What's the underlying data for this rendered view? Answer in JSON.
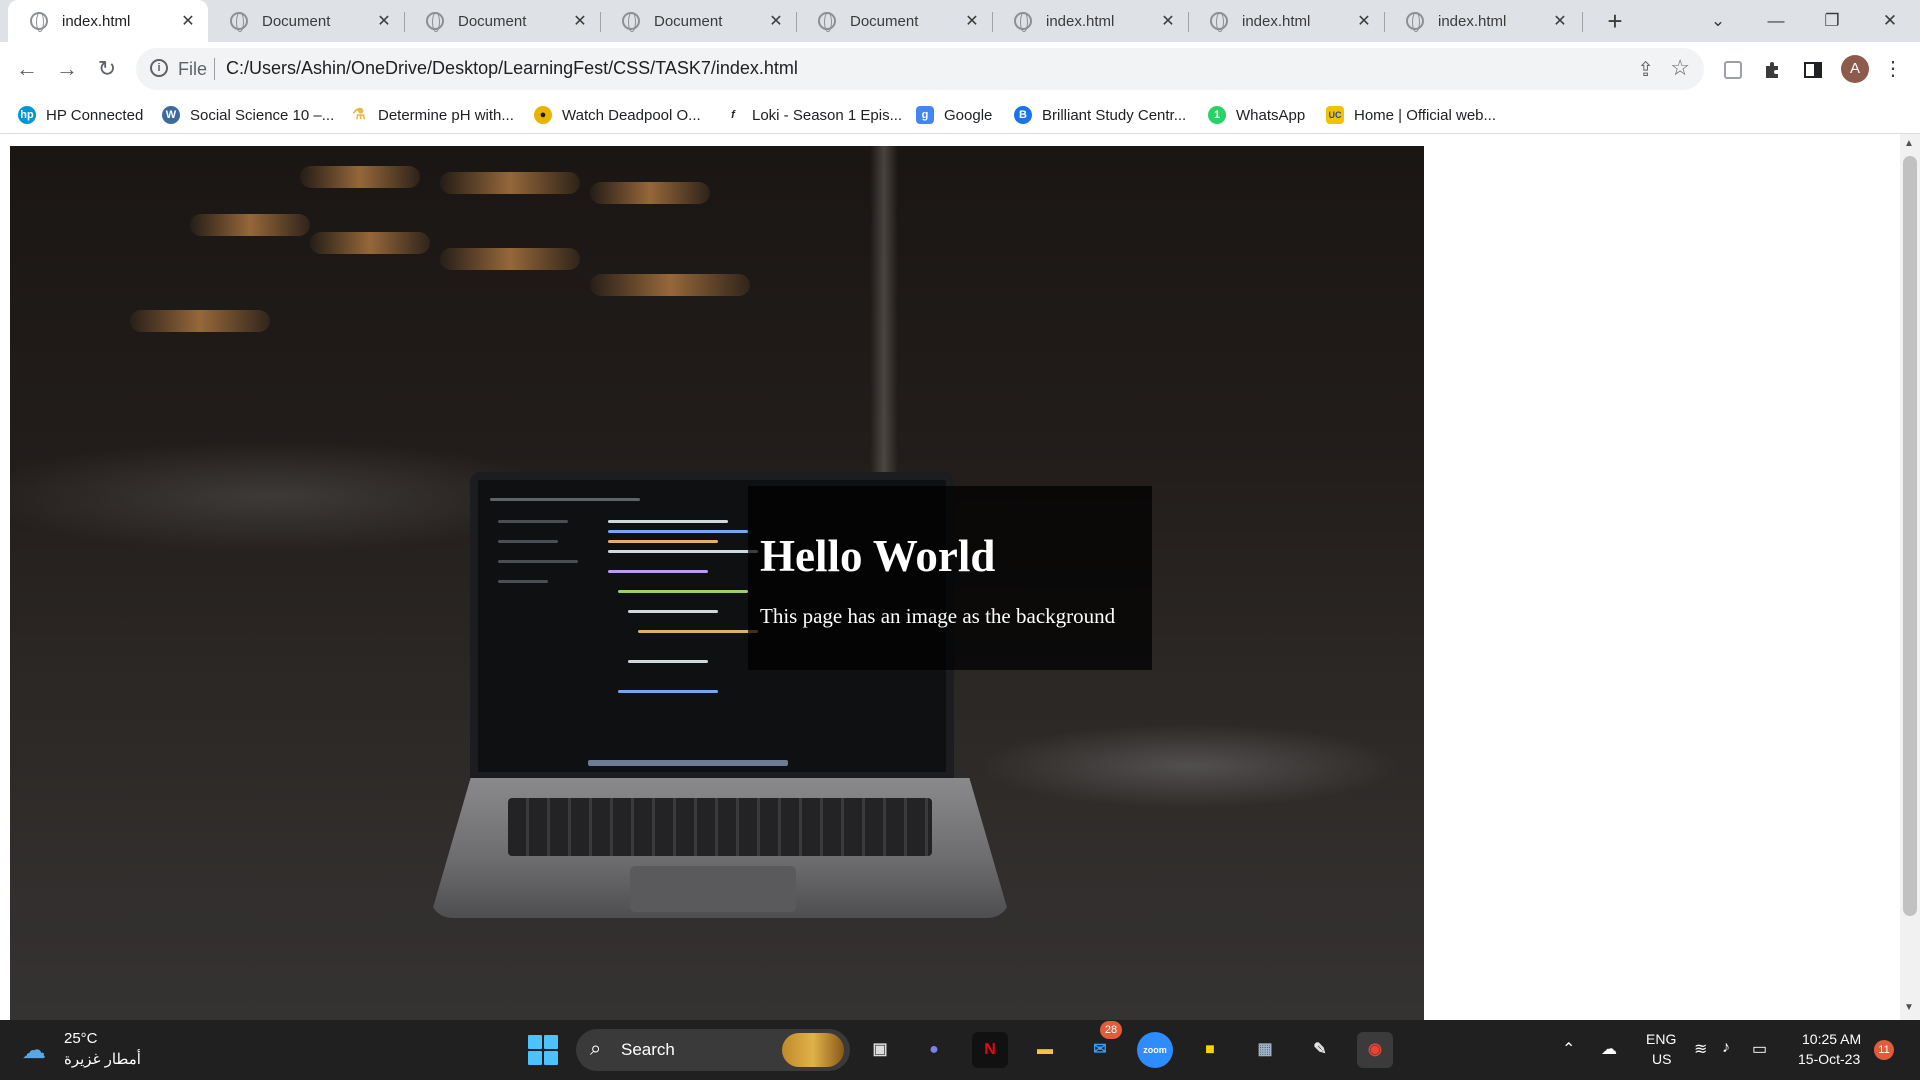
{
  "tabs": [
    {
      "title": "index.html",
      "active": true
    },
    {
      "title": "Document",
      "active": false
    },
    {
      "title": "Document",
      "active": false
    },
    {
      "title": "Document",
      "active": false
    },
    {
      "title": "Document",
      "active": false
    },
    {
      "title": "index.html",
      "active": false
    },
    {
      "title": "index.html",
      "active": false
    },
    {
      "title": "index.html",
      "active": false
    }
  ],
  "tab_close_glyph": "✕",
  "new_tab_glyph": "+",
  "window_controls": {
    "tab_search": "⌄",
    "minimize": "—",
    "restore": "❐",
    "close": "✕"
  },
  "toolbar": {
    "back": "←",
    "forward": "→",
    "reload": "↻",
    "info_glyph": "i",
    "scheme_label": "File",
    "url": "C:/Users/Ashin/OneDrive/Desktop/LearningFest/CSS/TASK7/index.html",
    "share_glyph": "⇪",
    "star_glyph": "☆",
    "extensions": [
      "reading-list-icon",
      "puzzle-icon",
      "side-panel-icon"
    ],
    "profile_initial": "A",
    "menu_glyph": "⋮"
  },
  "bookmarks": [
    {
      "label": "HP Connected",
      "icon": "hp-icon",
      "color": "#0096d6",
      "glyph": "hp"
    },
    {
      "label": "Social Science 10 –...",
      "icon": "wordpress-icon",
      "color": "#3b6b9e",
      "glyph": "W"
    },
    {
      "label": "Determine pH with...",
      "icon": "flask-icon",
      "color": "#e8b84a",
      "glyph": "⚗"
    },
    {
      "label": "Watch Deadpool O...",
      "icon": "deadpool-icon",
      "color": "#1a1a1a",
      "glyph": "●"
    },
    {
      "label": "Loki - Season 1 Epis...",
      "icon": "fmovies-icon",
      "color": "#222222",
      "glyph": "f"
    },
    {
      "label": "Google",
      "icon": "google-g-icon",
      "color": "#4285f4",
      "glyph": "g"
    },
    {
      "label": "Brilliant Study Centr...",
      "icon": "brilliant-icon",
      "color": "#1a73e8",
      "glyph": "B"
    },
    {
      "label": "WhatsApp",
      "icon": "whatsapp-icon",
      "color": "#25d366",
      "glyph": "1"
    },
    {
      "label": "Home | Official web...",
      "icon": "uc-icon",
      "color": "#1f4e9e",
      "glyph": "UC"
    }
  ],
  "page": {
    "heading": "Hello World",
    "paragraph": "This page has an image as the background"
  },
  "scrollbar": {
    "up": "▲",
    "down": "▼"
  },
  "taskbar": {
    "weather_temp": "25°C",
    "weather_desc": "أمطار غزيرة",
    "search_label": "Search",
    "mail_badge": "28",
    "apps": [
      "start",
      "search",
      "task-view",
      "teams",
      "netflix",
      "file-explorer",
      "mail",
      "zoom",
      "sticky-notes",
      "calculator",
      "notepad",
      "chrome"
    ],
    "lang_line1": "ENG",
    "lang_line2": "US",
    "time": "10:25 AM",
    "date": "15-Oct-23",
    "notifications": "11"
  }
}
